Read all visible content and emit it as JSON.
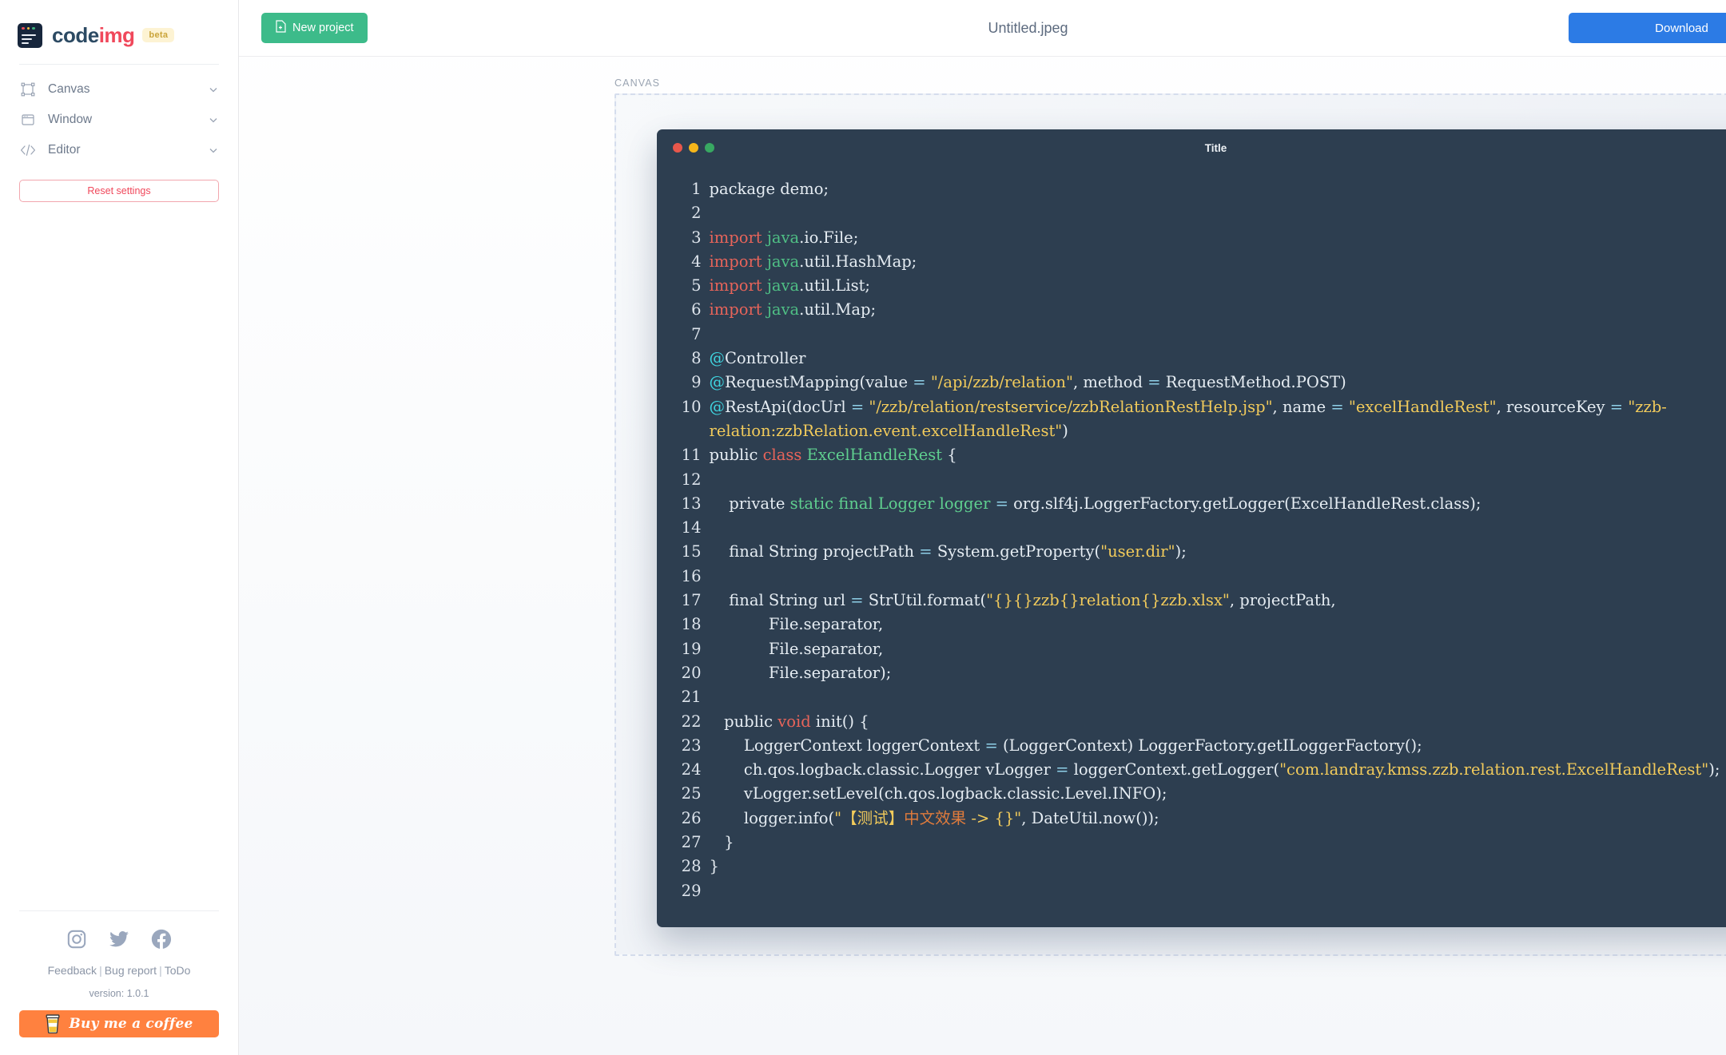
{
  "brand": {
    "name_part1": "code",
    "name_part2": "img",
    "badge": "beta",
    "logo_icon": "codeimg-logo-icon"
  },
  "sidebar": {
    "items": [
      {
        "label": "Canvas",
        "icon": "canvas-frame-icon",
        "chevron": "chevron-down-icon"
      },
      {
        "label": "Window",
        "icon": "window-icon",
        "chevron": "chevron-down-icon"
      },
      {
        "label": "Editor",
        "icon": "code-brackets-icon",
        "chevron": "chevron-down-icon"
      }
    ],
    "reset_label": "Reset settings",
    "footer": {
      "socials": [
        {
          "name": "instagram-icon"
        },
        {
          "name": "twitter-icon"
        },
        {
          "name": "facebook-icon"
        }
      ],
      "links": [
        "Feedback",
        "Bug report",
        "ToDo"
      ],
      "separator": "|",
      "version": "version: 1.0.1",
      "coffee_label": "Buy me a coffee",
      "coffee_icon": "coffee-cup-icon",
      "coffee_color": "#ff813f"
    }
  },
  "topbar": {
    "new_project_label": "New project",
    "new_project_icon": "new-file-icon",
    "new_project_color": "#3dbb8a",
    "document_title": "Untitled.jpeg",
    "download_label": "Download",
    "download_color": "#2c7be5"
  },
  "canvas": {
    "label": "CANVAS",
    "window_title": "Title",
    "traffic_lights": [
      "close-red-dot",
      "minimize-yellow-dot",
      "maximize-green-dot"
    ],
    "background": "#2d3e50"
  },
  "code": {
    "language": "java",
    "lines": [
      {
        "n": "1",
        "tokens": [
          {
            "t": "plain",
            "v": "package demo;"
          }
        ]
      },
      {
        "n": "2",
        "tokens": []
      },
      {
        "n": "3",
        "tokens": [
          {
            "t": "kw",
            "v": "import"
          },
          {
            "t": "plain",
            "v": " "
          },
          {
            "t": "pkg",
            "v": "java"
          },
          {
            "t": "plain",
            "v": ".io.File;"
          }
        ]
      },
      {
        "n": "4",
        "tokens": [
          {
            "t": "kw",
            "v": "import"
          },
          {
            "t": "plain",
            "v": " "
          },
          {
            "t": "pkg",
            "v": "java"
          },
          {
            "t": "plain",
            "v": ".util.HashMap;"
          }
        ]
      },
      {
        "n": "5",
        "tokens": [
          {
            "t": "kw",
            "v": "import"
          },
          {
            "t": "plain",
            "v": " "
          },
          {
            "t": "pkg",
            "v": "java"
          },
          {
            "t": "plain",
            "v": ".util.List;"
          }
        ]
      },
      {
        "n": "6",
        "tokens": [
          {
            "t": "kw",
            "v": "import"
          },
          {
            "t": "plain",
            "v": " "
          },
          {
            "t": "pkg",
            "v": "java"
          },
          {
            "t": "plain",
            "v": ".util.Map;"
          }
        ]
      },
      {
        "n": "7",
        "tokens": []
      },
      {
        "n": "8",
        "tokens": [
          {
            "t": "ann",
            "v": "@"
          },
          {
            "t": "plain",
            "v": "Controller"
          }
        ]
      },
      {
        "n": "9",
        "tokens": [
          {
            "t": "ann",
            "v": "@"
          },
          {
            "t": "plain",
            "v": "RequestMapping(value "
          },
          {
            "t": "op",
            "v": "="
          },
          {
            "t": "plain",
            "v": " "
          },
          {
            "t": "str",
            "v": "\"/api/zzb/relation\""
          },
          {
            "t": "plain",
            "v": ", method "
          },
          {
            "t": "op",
            "v": "="
          },
          {
            "t": "plain",
            "v": " RequestMethod.POST)"
          }
        ]
      },
      {
        "n": "10",
        "tokens": [
          {
            "t": "ann",
            "v": "@"
          },
          {
            "t": "plain",
            "v": "RestApi(docUrl "
          },
          {
            "t": "op",
            "v": "="
          },
          {
            "t": "plain",
            "v": " "
          },
          {
            "t": "str",
            "v": "\"/zzb/relation/restservice/zzbRelationRestHelp.jsp\""
          },
          {
            "t": "plain",
            "v": ", name "
          },
          {
            "t": "op",
            "v": "="
          },
          {
            "t": "plain",
            "v": " "
          },
          {
            "t": "str",
            "v": "\"excelHandleRest\""
          },
          {
            "t": "plain",
            "v": ", resourceKey "
          },
          {
            "t": "op",
            "v": "="
          },
          {
            "t": "plain",
            "v": " "
          },
          {
            "t": "str",
            "v": "\"zzb-relation:zzbRelation.event.excelHandleRest\""
          },
          {
            "t": "plain",
            "v": ")"
          }
        ]
      },
      {
        "n": "11",
        "tokens": [
          {
            "t": "plain",
            "v": "public "
          },
          {
            "t": "kw",
            "v": "class"
          },
          {
            "t": "plain",
            "v": " "
          },
          {
            "t": "type",
            "v": "ExcelHandleRest"
          },
          {
            "t": "plain",
            "v": " {"
          }
        ]
      },
      {
        "n": "12",
        "tokens": []
      },
      {
        "n": "13",
        "tokens": [
          {
            "t": "plain",
            "v": "    private "
          },
          {
            "t": "type",
            "v": "static final"
          },
          {
            "t": "plain",
            "v": " "
          },
          {
            "t": "type",
            "v": "Logger"
          },
          {
            "t": "plain",
            "v": " "
          },
          {
            "t": "type",
            "v": "logger"
          },
          {
            "t": "plain",
            "v": " "
          },
          {
            "t": "op",
            "v": "="
          },
          {
            "t": "plain",
            "v": " org.slf4j.LoggerFactory.getLogger(ExcelHandleRest.class);"
          }
        ]
      },
      {
        "n": "14",
        "tokens": []
      },
      {
        "n": "15",
        "tokens": [
          {
            "t": "plain",
            "v": "    final String projectPath "
          },
          {
            "t": "op",
            "v": "="
          },
          {
            "t": "plain",
            "v": " System.getProperty("
          },
          {
            "t": "str",
            "v": "\"user.dir\""
          },
          {
            "t": "plain",
            "v": ");"
          }
        ]
      },
      {
        "n": "16",
        "tokens": []
      },
      {
        "n": "17",
        "tokens": [
          {
            "t": "plain",
            "v": "    final String url "
          },
          {
            "t": "op",
            "v": "="
          },
          {
            "t": "plain",
            "v": " StrUtil.format("
          },
          {
            "t": "str",
            "v": "\"{}{}zzb{}relation{}zzb.xlsx\""
          },
          {
            "t": "plain",
            "v": ", projectPath,"
          }
        ]
      },
      {
        "n": "18",
        "tokens": [
          {
            "t": "plain",
            "v": "            File.separator,"
          }
        ]
      },
      {
        "n": "19",
        "tokens": [
          {
            "t": "plain",
            "v": "            File.separator,"
          }
        ]
      },
      {
        "n": "20",
        "tokens": [
          {
            "t": "plain",
            "v": "            File.separator);"
          }
        ]
      },
      {
        "n": "21",
        "tokens": []
      },
      {
        "n": "22",
        "tokens": [
          {
            "t": "plain",
            "v": "   public "
          },
          {
            "t": "kw",
            "v": "void"
          },
          {
            "t": "plain",
            "v": " init() {"
          }
        ]
      },
      {
        "n": "23",
        "tokens": [
          {
            "t": "plain",
            "v": "       LoggerContext loggerContext "
          },
          {
            "t": "op",
            "v": "="
          },
          {
            "t": "plain",
            "v": " (LoggerContext) LoggerFactory.getILoggerFactory();"
          }
        ]
      },
      {
        "n": "24",
        "tokens": [
          {
            "t": "plain",
            "v": "       ch.qos.logback.classic.Logger vLogger "
          },
          {
            "t": "op",
            "v": "="
          },
          {
            "t": "plain",
            "v": " loggerContext.getLogger("
          },
          {
            "t": "str",
            "v": "\"com.landray.kmss.zzb.relation.rest.ExcelHandleRest\""
          },
          {
            "t": "plain",
            "v": ");"
          }
        ]
      },
      {
        "n": "25",
        "tokens": [
          {
            "t": "plain",
            "v": "       vLogger.setLevel(ch.qos.logback.classic.Level.INFO);"
          }
        ]
      },
      {
        "n": "26",
        "tokens": [
          {
            "t": "plain",
            "v": "       logger.info("
          },
          {
            "t": "str",
            "v": "\""
          },
          {
            "t": "str",
            "v": "【测试】"
          },
          {
            "t": "cjk",
            "v": "中文效果"
          },
          {
            "t": "str",
            "v": " -> {}\""
          },
          {
            "t": "plain",
            "v": ", DateUtil.now());"
          }
        ]
      },
      {
        "n": "27",
        "tokens": [
          {
            "t": "plain",
            "v": "   }"
          }
        ]
      },
      {
        "n": "28",
        "tokens": [
          {
            "t": "plain",
            "v": "}"
          }
        ]
      },
      {
        "n": "29",
        "tokens": []
      }
    ]
  }
}
